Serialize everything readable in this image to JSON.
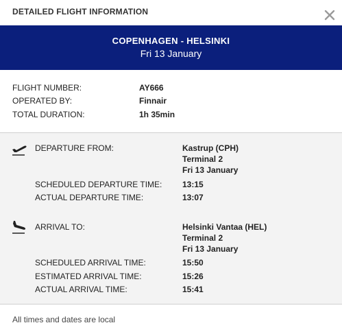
{
  "modal": {
    "title": "DETAILED FLIGHT INFORMATION",
    "close_icon": "close-icon"
  },
  "route": {
    "title": "COPENHAGEN - HELSINKI",
    "date": "Fri 13 January",
    "banner_color": "#0b1f7c"
  },
  "summary": {
    "flight_number_label": "FLIGHT NUMBER:",
    "flight_number": "AY666",
    "operated_by_label": "OPERATED BY:",
    "operated_by": "Finnair",
    "total_duration_label": "TOTAL DURATION:",
    "total_duration": "1h 35min"
  },
  "departure": {
    "icon": "plane-takeoff-icon",
    "from_label": "DEPARTURE FROM:",
    "airport": "Kastrup (CPH)",
    "terminal": "Terminal 2",
    "date": "Fri 13 January",
    "scheduled_label": "SCHEDULED DEPARTURE TIME:",
    "scheduled_time": "13:15",
    "actual_label": "ACTUAL DEPARTURE TIME:",
    "actual_time": "13:07"
  },
  "arrival": {
    "icon": "plane-landing-icon",
    "to_label": "ARRIVAL TO:",
    "airport": "Helsinki Vantaa (HEL)",
    "terminal": "Terminal 2",
    "date": "Fri 13 January",
    "scheduled_label": "SCHEDULED ARRIVAL TIME:",
    "scheduled_time": "15:50",
    "estimated_label": "ESTIMATED ARRIVAL TIME:",
    "estimated_time": "15:26",
    "actual_label": "ACTUAL ARRIVAL TIME:",
    "actual_time": "15:41"
  },
  "footer": {
    "note": "All times and dates are local"
  }
}
